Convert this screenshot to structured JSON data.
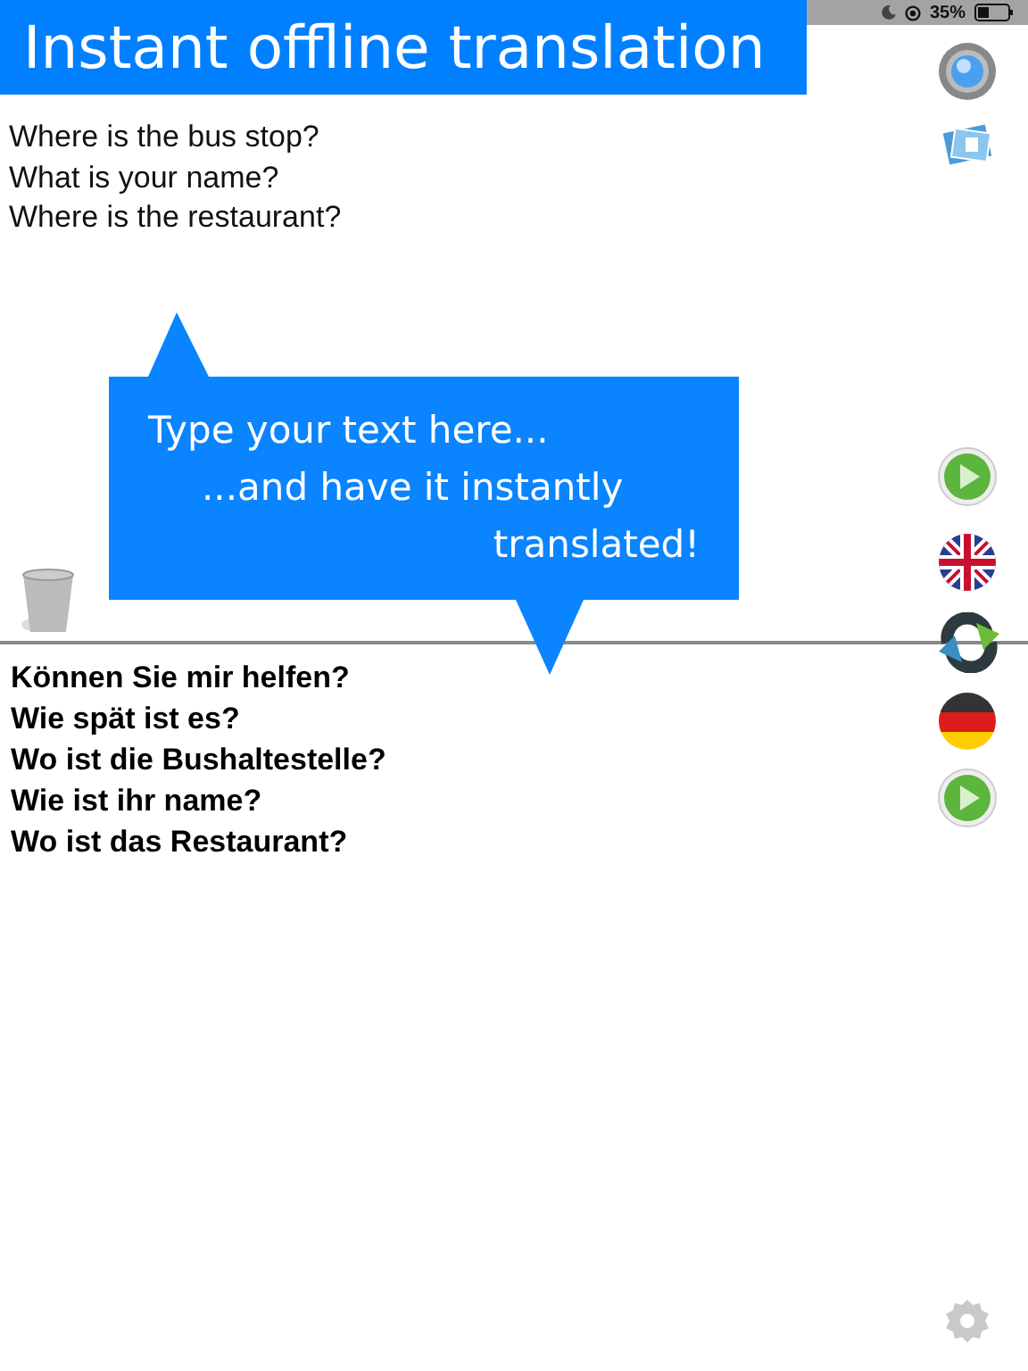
{
  "status_bar": {
    "battery": "35%"
  },
  "banner": {
    "title": "Instant offline translation"
  },
  "source_lines": [
    "Where is the bus stop?",
    "What is your name?",
    "Where is the restaurant?"
  ],
  "callout": {
    "lines": [
      "Type your text here...",
      "...and have it instantly",
      "translated!"
    ]
  },
  "translated_lines": [
    "Können Sie mir helfen?",
    "Wie spät ist es?",
    "Wo ist die Bushaltestelle?",
    "Wie ist ihr name?",
    "Wo ist das Restaurant?"
  ]
}
